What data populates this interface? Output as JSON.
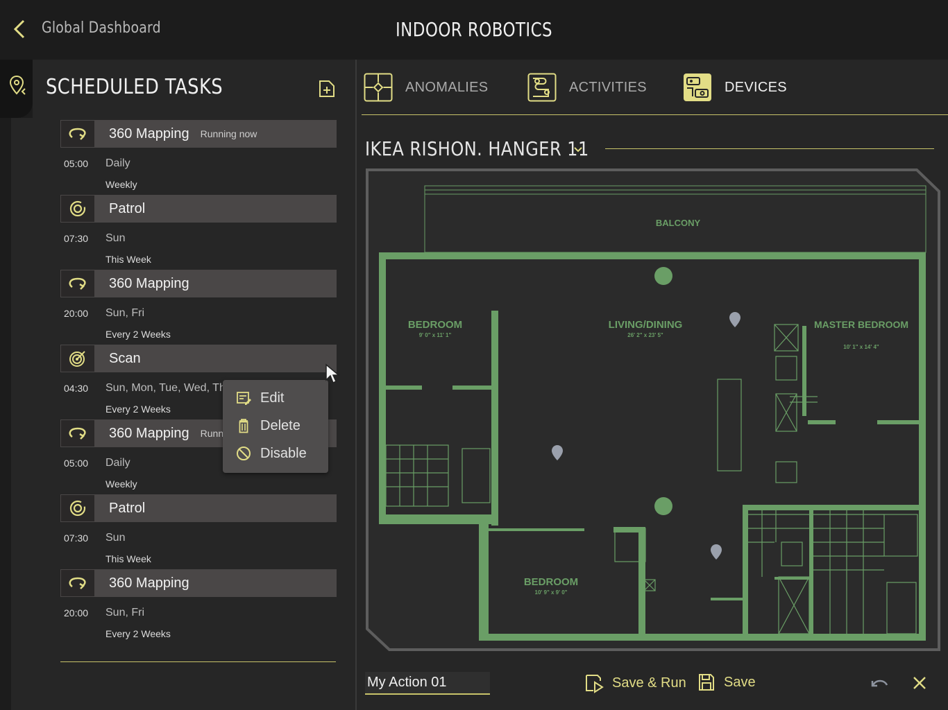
{
  "header": {
    "back_label": "Global Dashboard",
    "app_title": "INDOOR ROBOTICS"
  },
  "tasks_panel": {
    "title": "SCHEDULED TASKS",
    "tasks": [
      {
        "name": "360 Mapping",
        "type": "mapping",
        "status": "Running now",
        "time": "05:00",
        "days": "Daily",
        "repeat": "Weekly"
      },
      {
        "name": "Patrol",
        "type": "patrol",
        "status": "",
        "time": "07:30",
        "days": "Sun",
        "repeat": "This Week"
      },
      {
        "name": "360 Mapping",
        "type": "mapping",
        "status": "",
        "time": "20:00",
        "days": "Sun, Fri",
        "repeat": "Every 2  Weeks"
      },
      {
        "name": "Scan",
        "type": "scan",
        "status": "",
        "time": "04:30",
        "days": "Sun, Mon, Tue, Wed, Thu",
        "repeat": "Every 2  Weeks"
      },
      {
        "name": "360 Mapping",
        "type": "mapping",
        "status": "Running now",
        "time": "05:00",
        "days": "Daily",
        "repeat": "Weekly"
      },
      {
        "name": "Patrol",
        "type": "patrol",
        "status": "",
        "time": "07:30",
        "days": "Sun",
        "repeat": "This Week"
      },
      {
        "name": "360 Mapping",
        "type": "mapping",
        "status": "",
        "time": "20:00",
        "days": "Sun, Fri",
        "repeat": "Every 2  Weeks"
      }
    ]
  },
  "context_menu": {
    "items": [
      {
        "label": "Edit",
        "icon": "edit-list-icon"
      },
      {
        "label": "Delete",
        "icon": "trash-icon"
      },
      {
        "label": "Disable",
        "icon": "block-icon"
      }
    ]
  },
  "tabs": [
    {
      "label": "ANOMALIES",
      "icon": "anomalies-icon",
      "active": false
    },
    {
      "label": "ACTIVITIES",
      "icon": "activities-icon",
      "active": false
    },
    {
      "label": "DEVICES",
      "icon": "devices-icon",
      "active": true
    }
  ],
  "map": {
    "selected": "IKEA RISHON. HANGER 11",
    "rooms": [
      {
        "label": "BALCONY",
        "dims": ""
      },
      {
        "label": "BEDROOM",
        "dims": "9' 0\" x 11' 1\""
      },
      {
        "label": "LIVING/DINING",
        "dims": "26' 2\" x 23' 5\""
      },
      {
        "label": "MASTER BEDROOM",
        "dims": "10' 1\" x 14' 4\""
      },
      {
        "label": "BEDROOM",
        "dims": "10' 9\" x 9' 0\""
      }
    ]
  },
  "footer": {
    "action_name": "My Action 01",
    "save_run_label": "Save  & Run",
    "save_label": "Save"
  },
  "colors": {
    "accent": "#e2dd86",
    "floorplan_wall": "#6a9e66",
    "panel_bg": "#262626",
    "task_bar": "#4a4747"
  }
}
